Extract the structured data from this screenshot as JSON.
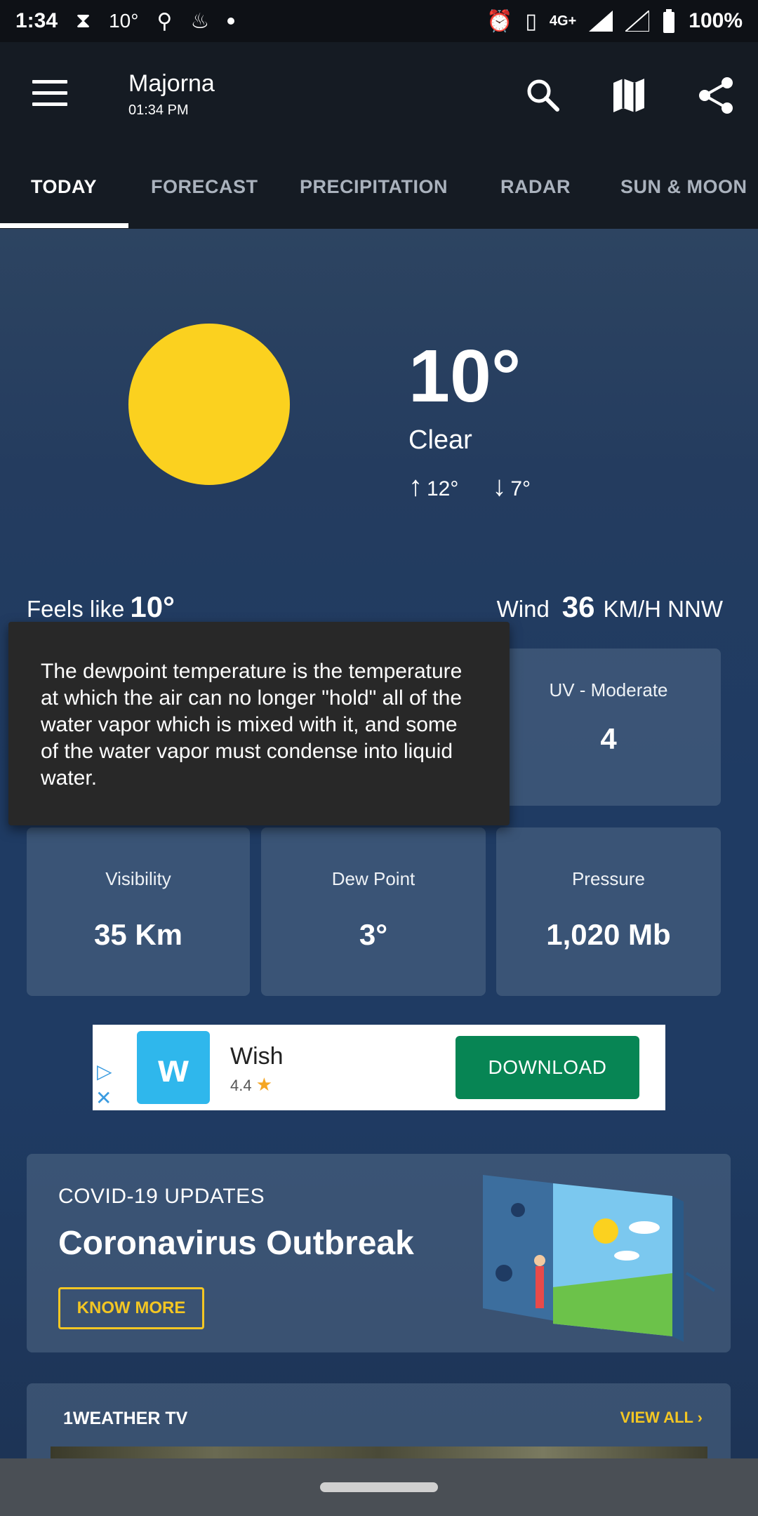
{
  "status_bar": {
    "time": "1:34",
    "temp": "10°",
    "battery": "100%",
    "network": "4G+"
  },
  "header": {
    "location": "Majorna",
    "time": "01:34 PM"
  },
  "tabs": [
    {
      "label": "TODAY"
    },
    {
      "label": "FORECAST"
    },
    {
      "label": "PRECIPITATION"
    },
    {
      "label": "RADAR"
    },
    {
      "label": "SUN & MOON"
    }
  ],
  "current": {
    "temp": "10°",
    "condition": "Clear",
    "high": "12°",
    "low": "7°",
    "feels_label": "Feels like",
    "feels_value": "10°",
    "wind_label": "Wind",
    "wind_value": "36",
    "wind_unit": "KM/H NNW"
  },
  "tooltip": {
    "text": "The dewpoint temperature is the temperature at which the air can no longer \"hold\" all of the water vapor which is mixed with it, and some of the water vapor must condense into liquid water."
  },
  "cards": [
    {
      "label": "UV - Moderate",
      "value": "4"
    },
    {
      "label": "Visibility",
      "value": "35 Km"
    },
    {
      "label": "Dew Point",
      "value": "3°"
    },
    {
      "label": "Pressure",
      "value": "1,020 Mb"
    }
  ],
  "ad": {
    "name": "Wish",
    "rating": "4.4",
    "button": "DOWNLOAD"
  },
  "covid": {
    "eyebrow": "COVID-19 UPDATES",
    "title": "Coronavirus Outbreak",
    "button": "KNOW MORE"
  },
  "tv": {
    "title": "1WEATHER TV",
    "link": "VIEW ALL"
  },
  "colors": {
    "sun": "#fbd11f",
    "accent": "#f3c623",
    "download": "#078554"
  }
}
